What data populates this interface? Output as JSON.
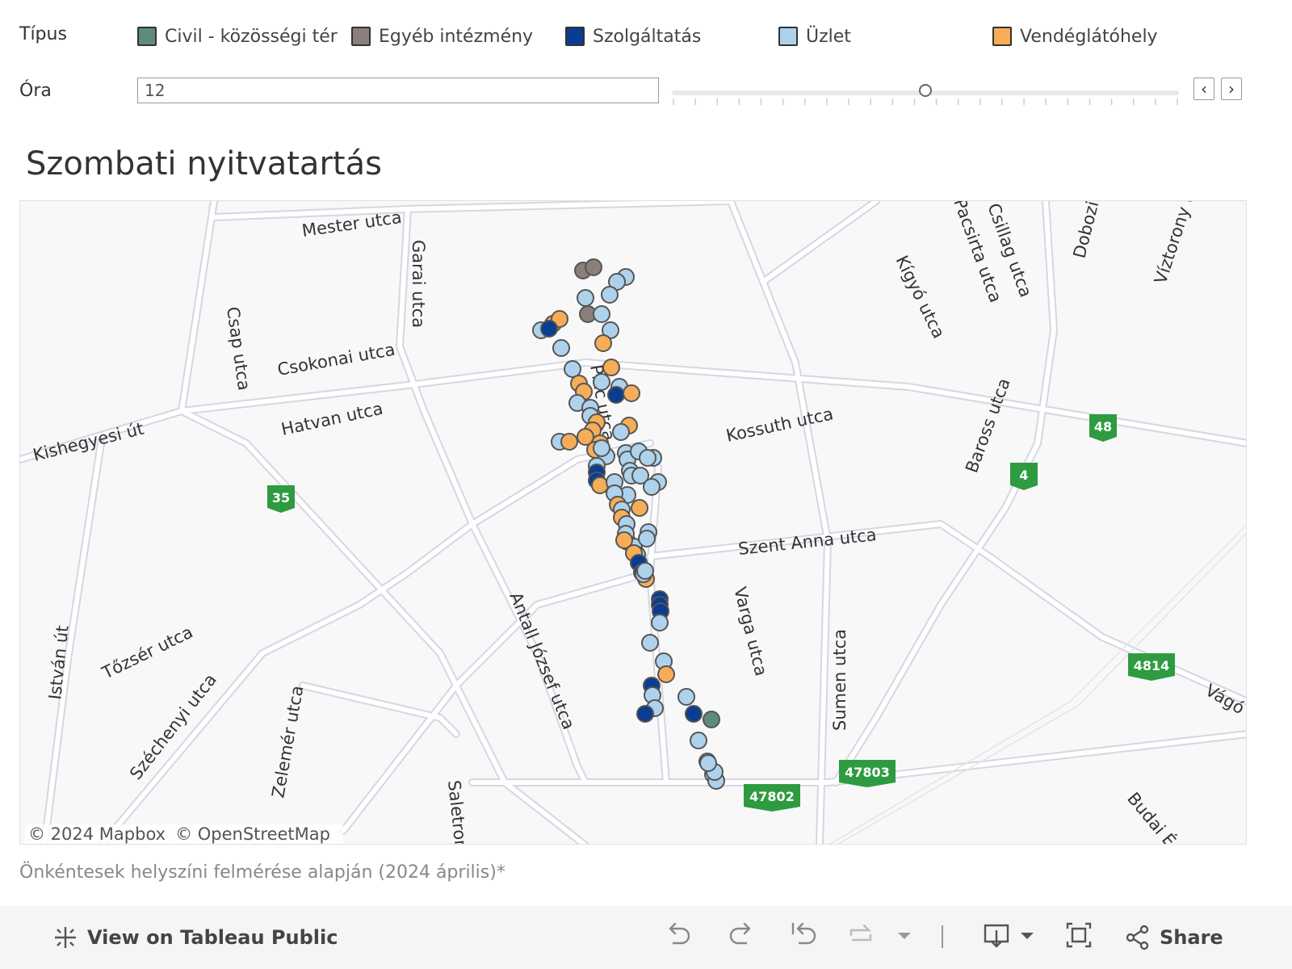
{
  "legend": {
    "title": "Típus",
    "items": [
      {
        "label": "Civil - közösségi tér",
        "color": "#5f8c7a"
      },
      {
        "label": "Egyéb intézmény",
        "color": "#8a7f7a"
      },
      {
        "label": "Szolgáltatás",
        "color": "#0a3d91"
      },
      {
        "label": "Üzlet",
        "color": "#aed2ec"
      },
      {
        "label": "Vendéglátóhely",
        "color": "#f6ad58"
      }
    ]
  },
  "hour_filter": {
    "label": "Óra",
    "value": "12",
    "slider_fraction": 0.5,
    "prev_icon": "‹",
    "next_icon": "›"
  },
  "title": "Szombati nyitvatartás",
  "map": {
    "street_labels": [
      "Mester utca",
      "Garai utca",
      "Csap utca",
      "Csokonai utca",
      "Hatvan utca",
      "Kishegyesi út",
      "Piac utca",
      "Kossuth utca",
      "Szent Anna utca",
      "Antall József utca",
      "Varga utca",
      "Sumen utca",
      "Tőzsér utca",
      "Széchenyi utca",
      "Zelemér utca",
      "István út",
      "Saletrom",
      "Kígyó utca",
      "Pacsirta utca",
      "Csillag utca",
      "Dobozi",
      "Víztorony u",
      "Baross utca",
      "Vágó",
      "Budai É"
    ],
    "road_numbers": [
      "35",
      "48",
      "4",
      "4814",
      "47802",
      "47803"
    ],
    "attribution": [
      "© 2024 Mapbox",
      "© OpenStreetMap"
    ]
  },
  "footnote": "Önkéntesek helyszíni felmérése alapján (2024 április)*",
  "toolbar": {
    "view_label": "View on Tableau Public",
    "share_label": "Share"
  }
}
